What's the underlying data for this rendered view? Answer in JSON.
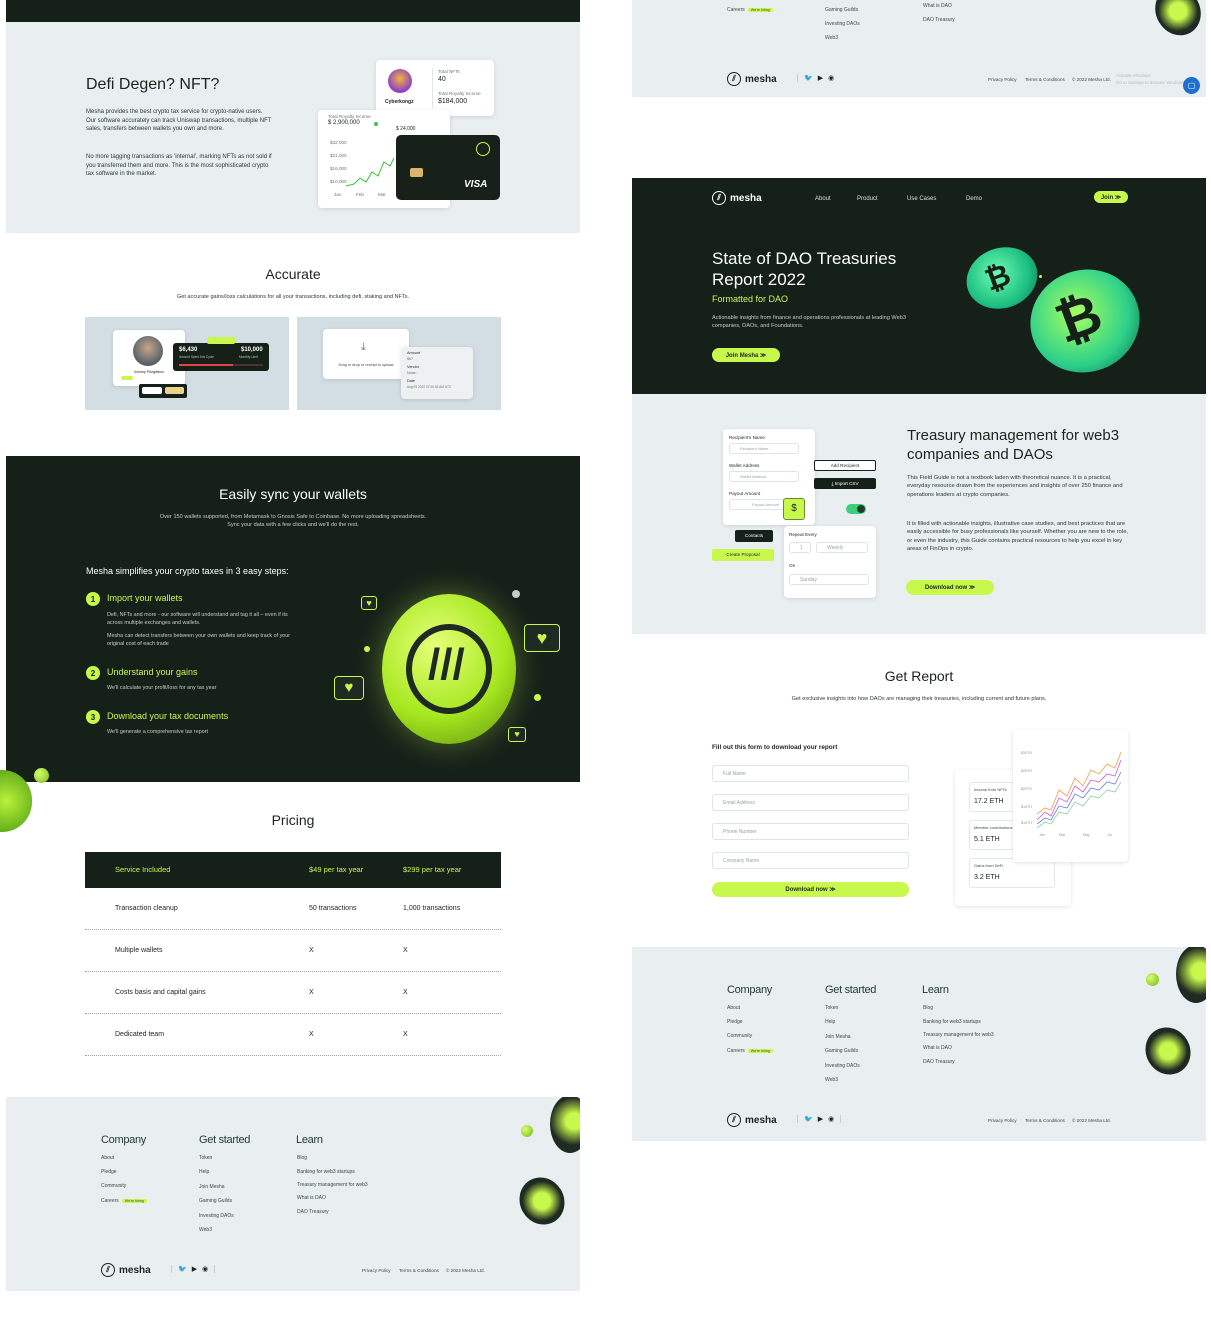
{
  "left": {
    "defi": {
      "title": "Defi Degen? NFT?",
      "para1": "Mesha provides the best crypto tax service for crypto-native users. Our software accurately can track Uniswap transactions, multiple NFT sales, transfers between wallets you own and more.",
      "para2": "No more tagging transactions as 'internal', marking NFTs as not sold if you transferred them and more. This is the most sophisticated crypto tax software in the market.",
      "nft_name": "Cyberkongz",
      "total_nfts_label": "Total NFTs",
      "total_nfts_value": "40",
      "royalty_label": "Total Royalty Income",
      "royalty_value": "$184,000",
      "chart_label": "Total Royalty Income",
      "chart_value": "$ 2,900,000",
      "chart_badge": "$ 24,000",
      "y_ticks": [
        "$32,000",
        "$21,000",
        "$16,000",
        "$10,000"
      ],
      "x_ticks": [
        "Jan",
        "Feb",
        "Mar"
      ],
      "card_brand": "VISA"
    },
    "accurate": {
      "title": "Accurate",
      "subtitle": "Get accurate gains/loss calculations for all your transactions, including defi, staking and NFTs.",
      "amount1": "$6,430",
      "amount1_label": "Amount Spent this Cycle",
      "amount2": "$10,000",
      "amount2_label": "Monthly Limit",
      "person": "Johnny Fitzgibbon",
      "upload_text": "Drag or drop or receipt to upload",
      "fields": [
        "Amount",
        "$67",
        "Vendor",
        "Nolan",
        "Date",
        "Aug 09 2022 07:20:42 AM UTC"
      ]
    },
    "sync": {
      "title": "Easily sync your wallets",
      "subtitle": "Over 150 wallets supported, from Metamask to Gnosis Safe to Coinbase. No more uploading spreadsheets. Sync your data with a few clicks and we'll do the rest.",
      "steps_title": "Mesha simplifies your crypto taxes in 3 easy steps:",
      "steps": [
        {
          "num": "1",
          "title": "Import your wallets",
          "desc1": "Defi, NFTs and more - our software will understand and tag it all – even if its across multiple exchanges and wallets.",
          "desc2": "Mesha can detect transfers between your own wallets and keep track of your original cost of each trade"
        },
        {
          "num": "2",
          "title": "Understand your gains",
          "desc1": "We'll calculate your profit/loss for any tax year",
          "desc2": ""
        },
        {
          "num": "3",
          "title": "Download your tax documents",
          "desc1": "We'll generate a comprehensive tax report",
          "desc2": ""
        }
      ]
    },
    "pricing": {
      "title": "Pricing",
      "headers": [
        "Service Included",
        "$49 per tax year",
        "$299 per tax year"
      ],
      "rows": [
        [
          "Transaction cleanup",
          "50 transactions",
          "1,000 transactions"
        ],
        [
          "Multiple wallets",
          "X",
          "X"
        ],
        [
          "Costs basis and capital gains",
          "X",
          "X"
        ],
        [
          "Dedicated team",
          "X",
          "X"
        ]
      ]
    },
    "footer": {
      "company_title": "Company",
      "company_links": [
        "About",
        "Pledge",
        "Community",
        "Careers"
      ],
      "hiring": "We're hiring",
      "started_title": "Get started",
      "started_links": [
        "Token",
        "Help",
        "Join Mesha",
        "Gaming Guilds",
        "Investing DAOs",
        "Web3"
      ],
      "learn_title": "Learn",
      "learn_links": [
        "Blog",
        "Banking for web3 startups",
        "Treasury management for web3",
        "What is DAO",
        "DAO Treasury"
      ],
      "brand": "mesha",
      "legal": [
        "Privacy Policy",
        "Terms & Conditions",
        "© 2022 Mesha Ltd."
      ]
    }
  },
  "right": {
    "top_footer": {
      "careers": "Careers",
      "hiring": "We're hiring",
      "started_links": [
        "Gaming Guilds",
        "Investing DAOs",
        "Web3"
      ],
      "learn_links": [
        "What is DAO",
        "DAO Treasury"
      ],
      "brand": "mesha",
      "legal": [
        "Privacy Policy",
        "Terms & Conditions",
        "© 2022 Mesha Ltd."
      ],
      "watermark1": "Activate Windows",
      "watermark2": "Go to Settings to activate Windows."
    },
    "nav": {
      "brand": "mesha",
      "items": [
        "About",
        "Product",
        "Use Cases",
        "Demo"
      ],
      "join": "Join ≫"
    },
    "hero": {
      "title": "State of DAO Treasuries Report 2022",
      "sub": "Formatted for DAO",
      "desc": "Actionable insights from finance and operations professionals at leading Web3 companies, DAOs, and Foundations.",
      "cta": "Join Mesha ≫"
    },
    "treasury": {
      "title": "Treasury management for web3 companies and DAOs",
      "p1": "This Field Guide is not a textbook laden with theoretical nuance. It is a practical, everyday resource drawn from the experiences and insights of over 250 finance and operations leaders at crypto companies.",
      "p2": "It is filled with actionable insights, illustrative case studies, and best practices that are easily accessible for busy professionals like yourself. Whether you are new to the role, or even the industry, this Guide contains practical resources to help you excel in key areas of FinOps in crypto.",
      "cta": "Download now ≫",
      "form": {
        "recipient_label": "Recipient's Name",
        "recipient_ph": "Recipient Name",
        "wallet_label": "Wallet Address",
        "wallet_ph": "Wallet Address",
        "payout_label": "Payout Amount",
        "payout_ph": "Payout Amount",
        "add_recipient": "Add Recipient",
        "import_csv": "Import CSV",
        "contacts": "Contacts",
        "create_proposal": "Create Proposal",
        "repeat_label": "Repeat Every",
        "repeat_num": "1",
        "repeat_unit": "Weekly",
        "on_label": "On",
        "on_value": "Sunday"
      }
    },
    "report": {
      "title": "Get Report",
      "subtitle": "Get exclusive insights into how DAOs are managing their treasuries, including current and future plans.",
      "form_title": "Fill out this form to download your report",
      "fields": [
        "Full Name",
        "Email Address",
        "Phone Number",
        "Company Name"
      ],
      "cta": "Download now ≫",
      "stats": [
        {
          "label": "Income from NFTs",
          "value": "17.2 ETH"
        },
        {
          "label": "Member contributions",
          "value": "5.1 ETH"
        },
        {
          "label": "Gains from DeFi",
          "value": "3.2 ETH"
        }
      ],
      "chart_y": [
        "$30TH",
        "$25TH",
        "$20TH",
        "$15TH",
        "$10TH"
      ],
      "chart_x": [
        "Jan",
        "Mar",
        "May",
        "Jul"
      ]
    },
    "footer": {
      "company_title": "Company",
      "company_links": [
        "About",
        "Pledge",
        "Community",
        "Careers"
      ],
      "hiring": "We're hiring",
      "started_title": "Get started",
      "started_links": [
        "Token",
        "Help",
        "Join Mesha",
        "Gaming Guilds",
        "Investing DAOs",
        "Web3"
      ],
      "learn_title": "Learn",
      "learn_links": [
        "Blog",
        "Banking for web3 startups",
        "Treasury management for web3",
        "What is DAO",
        "DAO Treasury"
      ],
      "brand": "mesha",
      "legal": [
        "Privacy Policy",
        "Terms & Conditions",
        "© 2022 Mesha Ltd."
      ]
    }
  },
  "colors": {
    "dark": "#152019",
    "lime": "#c9f84c",
    "light": "#e9eef0"
  }
}
